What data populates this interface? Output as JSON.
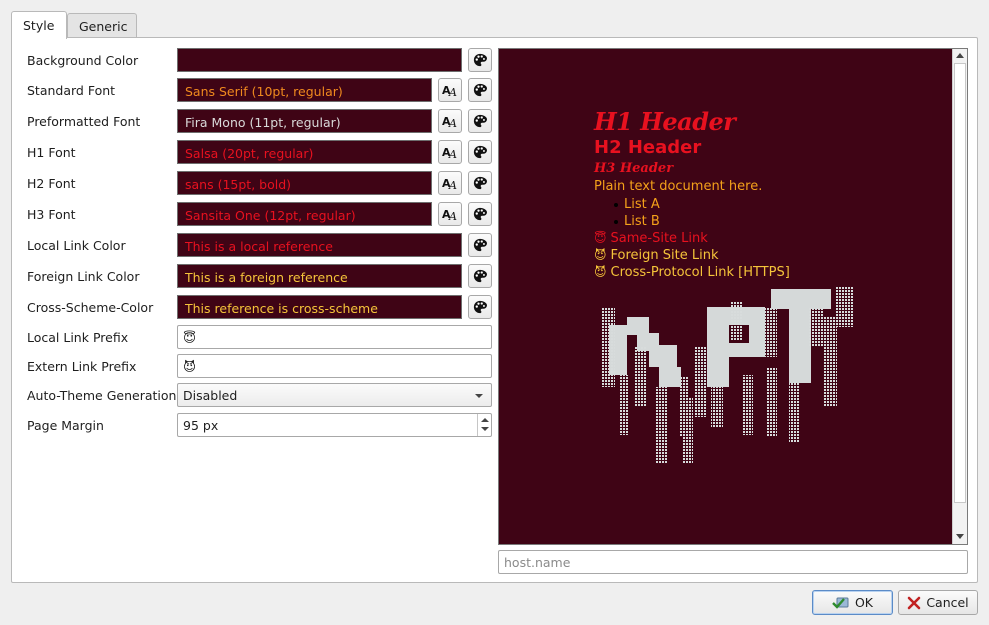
{
  "tabs": [
    {
      "label": "Style",
      "active": true
    },
    {
      "label": "Generic",
      "active": false
    }
  ],
  "colors": {
    "background": "#3f0415",
    "standard_font": "#f08a1e",
    "preformatted_font": "#d9d9d9",
    "header_font": "#e8111f",
    "local_link": "#e8111f",
    "foreign_link": "#f5c43a",
    "cross_scheme": "#f5c43a"
  },
  "form": {
    "background_color": {
      "label": "Background Color"
    },
    "standard_font": {
      "label": "Standard Font",
      "value": "Sans Serif (10pt, regular)"
    },
    "preformatted_font": {
      "label": "Preformatted Font",
      "value": "Fira Mono (11pt, regular)"
    },
    "h1_font": {
      "label": "H1 Font",
      "value": "Salsa (20pt, regular)"
    },
    "h2_font": {
      "label": "H2 Font",
      "value": "sans (15pt, bold)"
    },
    "h3_font": {
      "label": "H3 Font",
      "value": "Sansita One (12pt, regular)"
    },
    "local_link_color": {
      "label": "Local Link Color",
      "value": "This is a local reference"
    },
    "foreign_link_color": {
      "label": "Foreign Link Color",
      "value": "This is a foreign reference"
    },
    "cross_scheme_color": {
      "label": "Cross-Scheme-Color",
      "value": "This reference is cross-scheme"
    },
    "local_link_prefix": {
      "label": "Local Link Prefix",
      "value": "😇"
    },
    "extern_link_prefix": {
      "label": "Extern Link Prefix",
      "value": "😈"
    },
    "auto_theme": {
      "label": "Auto-Theme Generation",
      "value": "Disabled"
    },
    "page_margin": {
      "label": "Page Margin",
      "value": "95 px"
    }
  },
  "preview": {
    "h1": "H1 Header",
    "h2": "H2 Header",
    "h3": "H3 Header",
    "plain": "Plain text document here.",
    "list": [
      "List A",
      "List B"
    ],
    "links": {
      "same_site": {
        "prefix": "😇",
        "text": "Same-Site Link"
      },
      "foreign": {
        "prefix": "😈",
        "text": "Foreign Site Link"
      },
      "cross": {
        "prefix": "😈",
        "text": "Cross-Protocol Link [HTTPS]"
      }
    }
  },
  "host_field": {
    "placeholder": "host.name"
  },
  "buttons": {
    "ok": "OK",
    "cancel": "Cancel"
  }
}
